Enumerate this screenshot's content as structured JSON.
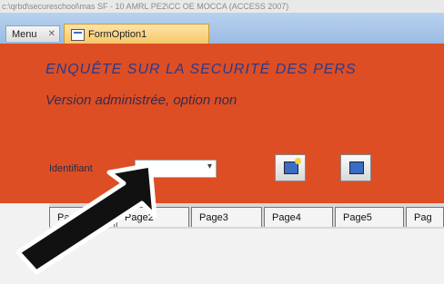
{
  "title_strip": "c:\\qrbd\\secureschool\\mas SF - 10 AMRL PE2\\CC OE MOCCA (ACCESS 2007)",
  "tabs": {
    "menu_label": "Menu",
    "form_label": "FormOption1"
  },
  "form": {
    "title_line1": "ENQUÊTE SUR LA SECURITÉ DES PERS",
    "title_line2": "Version administrée, option non",
    "id_label": "Identifiant",
    "id_value": ""
  },
  "page_tabs": [
    "Page1",
    "Page2",
    "Page3",
    "Page4",
    "Page5",
    "Pag"
  ],
  "colors": {
    "form_background": "#dd4e24",
    "tab_active": "#f7c86a",
    "tabbar": "#9bbbe2"
  },
  "icons": [
    "form-icon",
    "add-record-icon",
    "open-record-icon",
    "arrow-pointer-icon"
  ]
}
